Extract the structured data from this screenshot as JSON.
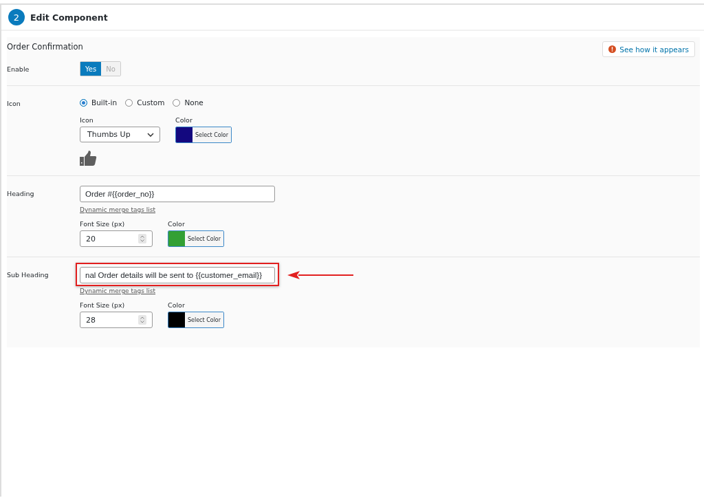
{
  "header": {
    "step": "2",
    "title": "Edit Component"
  },
  "section": {
    "title": "Order Confirmation",
    "preview_button": "See how it appears"
  },
  "enable": {
    "label": "Enable",
    "options": [
      {
        "label": "Yes",
        "selected": true
      },
      {
        "label": "No",
        "selected": false
      }
    ]
  },
  "icon": {
    "label": "Icon",
    "types": [
      {
        "label": "Built-in",
        "selected": true
      },
      {
        "label": "Custom",
        "selected": false
      },
      {
        "label": "None",
        "selected": false
      }
    ],
    "icon_label": "Icon",
    "icon_value": "Thumbs Up",
    "color_label": "Color",
    "color": "#13087f",
    "color_button": "Select Color"
  },
  "heading": {
    "label": "Heading",
    "value": "Order #{{order_no}}",
    "link": "Dynamic merge tags list",
    "size_label": "Font Size (px)",
    "size": "20",
    "color_label": "Color",
    "color": "#33a034",
    "color_button": "Select Color"
  },
  "sub_heading": {
    "label": "Sub Heading",
    "value": "nal Order details will be sent to {{customer_email}}",
    "link": "Dynamic merge tags list",
    "size_label": "Font Size (px)",
    "size": "28",
    "color_label": "Color",
    "color": "#000000",
    "color_button": "Select Color",
    "highlighted": true
  }
}
